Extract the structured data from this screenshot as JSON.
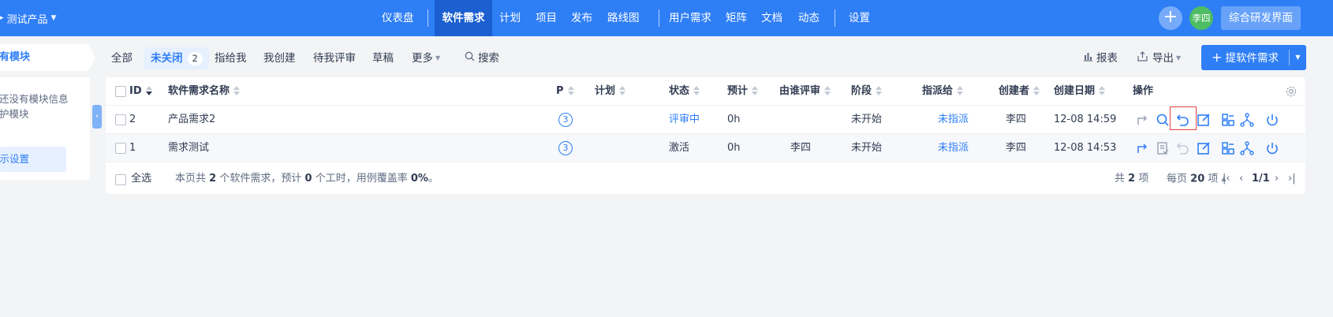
{
  "header": {
    "product": "测试产品",
    "nav": [
      {
        "label": "仪表盘"
      },
      {
        "label": "软件需求",
        "active": true
      },
      {
        "label": "计划"
      },
      {
        "label": "项目"
      },
      {
        "label": "发布"
      },
      {
        "label": "路线图"
      },
      {
        "label": "用户需求"
      },
      {
        "label": "矩阵"
      },
      {
        "label": "文档"
      },
      {
        "label": "动态"
      },
      {
        "label": "设置"
      }
    ],
    "user": "李四",
    "workspace_button": "综合研发界面"
  },
  "sidebar": {
    "tab": "所有模块",
    "info_line1": "暂时还没有模块信息",
    "info_line2": "请维护模块",
    "display_setting": "显示设置"
  },
  "featurebar": {
    "all": "全部",
    "unclosed": "未关闭",
    "unclosed_count": "2",
    "assigned_to_me": "指给我",
    "created_by_me": "我创建",
    "review_by_me": "待我评审",
    "draft": "草稿",
    "more": "更多",
    "search": "搜索"
  },
  "toolbar": {
    "report": "报表",
    "export": "导出",
    "create": "提软件需求"
  },
  "table": {
    "columns": {
      "id": "ID",
      "title": "软件需求名称",
      "pri": "P",
      "plan": "计划",
      "status": "状态",
      "estimate": "预计",
      "reviewer": "由谁评审",
      "stage": "阶段",
      "assigned": "指派给",
      "creator": "创建者",
      "created": "创建日期",
      "actions": "操作"
    },
    "rows": [
      {
        "id": "2",
        "title": "产品需求2",
        "pri": "3",
        "plan": "",
        "status": "评审中",
        "estimate": "0h",
        "reviewer": "",
        "stage": "未开始",
        "assigned": "未指派",
        "creator": "李四",
        "created": "12-08 14:59"
      },
      {
        "id": "1",
        "title": "需求测试",
        "pri": "3",
        "plan": "",
        "status": "激活",
        "estimate": "0h",
        "reviewer": "李四",
        "stage": "未开始",
        "assigned": "未指派",
        "creator": "李四",
        "created": "12-08 14:53"
      }
    ]
  },
  "footer": {
    "select_all": "全选",
    "summary_a": "本页共",
    "summary_count": "2",
    "summary_b": "个软件需求，预计",
    "summary_est": "0",
    "summary_c": "个工时，用例覆盖率",
    "summary_cov": "0%",
    "summary_d": "。",
    "total_a": "共",
    "total_n": "2",
    "total_b": "项",
    "per_a": "每页",
    "per_n": "20",
    "per_b": "项",
    "page": "1/1"
  },
  "colors": {
    "primary": "#2e7ef6",
    "nav_active": "#1b5fd0",
    "avatar": "#4ebd63",
    "highlight": "#e8423f"
  }
}
